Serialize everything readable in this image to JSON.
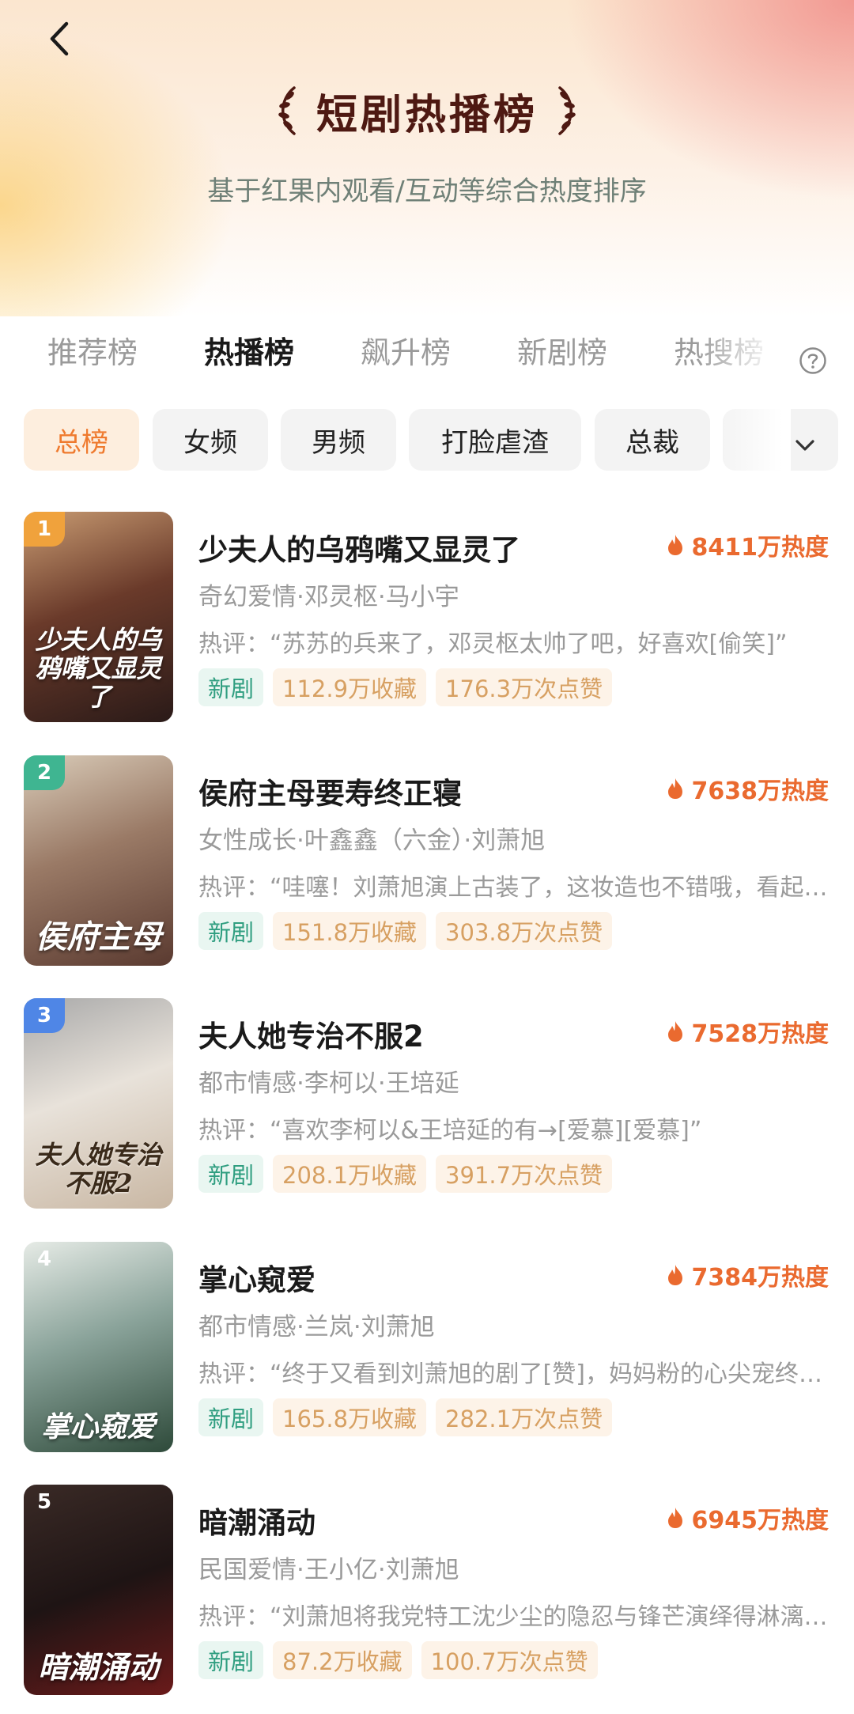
{
  "header": {
    "title": "短剧热播榜",
    "subtitle": "基于红果内观看/互动等综合热度排序"
  },
  "tabs": [
    {
      "label": "推荐榜",
      "active": false
    },
    {
      "label": "热播榜",
      "active": true
    },
    {
      "label": "飙升榜",
      "active": false
    },
    {
      "label": "新剧榜",
      "active": false
    },
    {
      "label": "热搜榜",
      "active": false
    }
  ],
  "chips": [
    {
      "label": "总榜",
      "active": true
    },
    {
      "label": "女频",
      "active": false
    },
    {
      "label": "男频",
      "active": false
    },
    {
      "label": "打脸虐渣",
      "active": false
    },
    {
      "label": "总裁",
      "active": false
    }
  ],
  "icons": {
    "back": "chevron-left-icon",
    "help": "question-circle-icon",
    "expand": "chevron-down-icon",
    "heat": "flame-icon"
  },
  "colors": {
    "accent": "#ef7a2e",
    "heat": "#ea6a2f",
    "title": "#4e1912",
    "new_tag": "#2f9e80",
    "stat_tag": "#d7a062",
    "rank_1": "#f0a23c",
    "rank_2": "#3fb591",
    "rank_3": "#4f86e6"
  },
  "dramas": [
    {
      "rank": "1",
      "title": "少夫人的乌鸦嘴又显灵了",
      "heat": "8411万热度",
      "meta": "奇幻爱情·邓灵枢·马小宇",
      "comment": "热评：“苏苏的兵来了，邓灵枢太帅了吧，好喜欢[偷笑]”",
      "tag_new": "新剧",
      "favorites": "112.9万收藏",
      "likes": "176.3万次点赞",
      "poster_text": "少夫人的乌鸦嘴又显灵了"
    },
    {
      "rank": "2",
      "title": "侯府主母要寿终正寝",
      "heat": "7638万热度",
      "meta": "女性成长·叶鑫鑫（六金）·刘萧旭",
      "comment": "热评：“哇噻！刘萧旭演上古装了，这妆造也不错哦，看起来很有感觉”",
      "tag_new": "新剧",
      "favorites": "151.8万收藏",
      "likes": "303.8万次点赞",
      "poster_text": "侯府主母"
    },
    {
      "rank": "3",
      "title": "夫人她专治不服2",
      "heat": "7528万热度",
      "meta": "都市情感·李柯以·王培延",
      "comment": "热评：“喜欢李柯以&王培延的有→[爱慕][爱慕]”",
      "tag_new": "新剧",
      "favorites": "208.1万收藏",
      "likes": "391.7万次点赞",
      "poster_text": "夫人她专治不服2"
    },
    {
      "rank": "4",
      "title": "掌心窥爱",
      "heat": "7384万热度",
      "meta": "都市情感·兰岚·刘萧旭",
      "comment": "热评：“终于又看到刘萧旭的剧了[赞]，妈妈粉的心尖宠终于回来了”",
      "tag_new": "新剧",
      "favorites": "165.8万收藏",
      "likes": "282.1万次点赞",
      "poster_text": "掌心窥爱"
    },
    {
      "rank": "5",
      "title": "暗潮涌动",
      "heat": "6945万热度",
      "meta": "民国爱情·王小亿·刘萧旭",
      "comment": "热评：“刘萧旭将我党特工沈少尘的隐忍与锋芒演绎得淋漓尽致”",
      "tag_new": "新剧",
      "favorites": "87.2万收藏",
      "likes": "100.7万次点赞",
      "poster_text": "暗潮涌动"
    }
  ]
}
